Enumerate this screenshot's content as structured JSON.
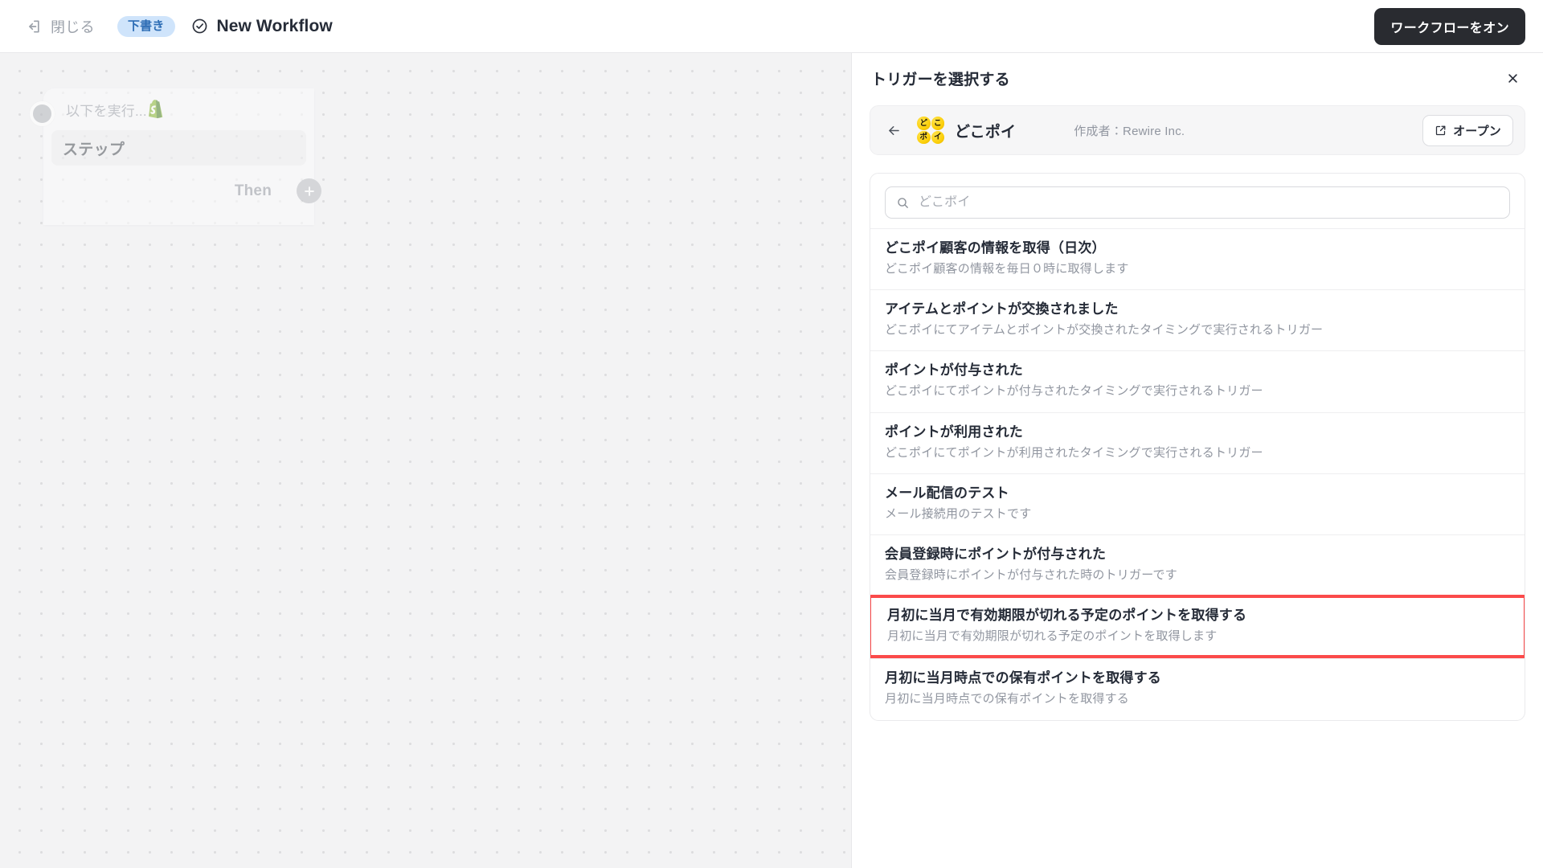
{
  "topbar": {
    "close_label": "閉じる",
    "close_icon": "exit-icon",
    "draft_badge": "下書き",
    "status_icon": "check-circle-icon",
    "workflow_title": "New Workflow",
    "activate_label": "ワークフローをオン",
    "accent_dark": "#292b30",
    "badge_bg": "#cfe4fb",
    "badge_fg": "#2d6db5"
  },
  "canvas": {
    "card": {
      "head_label": "以下を実行...",
      "app_icon": "shopify-icon",
      "step_label": "ステップ",
      "then_label": "Then",
      "add_icon": "plus-icon",
      "node_icon": "node-dot-icon"
    }
  },
  "panel": {
    "title": "トリガーを選択する",
    "close_icon": "close-icon",
    "app": {
      "back_icon": "arrow-left-icon",
      "logo_chars": [
        "ど",
        "こ",
        "ポ",
        "イ"
      ],
      "logo_color": "#fccf09",
      "name": "どこポイ",
      "author": "作成者：Rewire Inc.",
      "open_label": "オープン",
      "open_icon": "external-link-icon"
    },
    "search": {
      "icon": "search-icon",
      "value": "",
      "placeholder": "どこポイ"
    },
    "highlight_color": "#fb4a4a",
    "triggers": [
      {
        "name": "どこポイ顧客の情報を取得（日次）",
        "desc": "どこポイ顧客の情報を毎日０時に取得します",
        "highlighted": false
      },
      {
        "name": "アイテムとポイントが交換されました",
        "desc": "どこポイにてアイテムとポイントが交換されたタイミングで実行されるトリガー",
        "highlighted": false
      },
      {
        "name": "ポイントが付与された",
        "desc": "どこポイにてポイントが付与されたタイミングで実行されるトリガー",
        "highlighted": false
      },
      {
        "name": "ポイントが利用された",
        "desc": "どこポイにてポイントが利用されたタイミングで実行されるトリガー",
        "highlighted": false
      },
      {
        "name": "メール配信のテスト",
        "desc": "メール接続用のテストです",
        "highlighted": false
      },
      {
        "name": "会員登録時にポイントが付与された",
        "desc": "会員登録時にポイントが付与された時のトリガーです",
        "highlighted": false
      },
      {
        "name": "月初に当月で有効期限が切れる予定のポイントを取得する",
        "desc": "月初に当月で有効期限が切れる予定のポイントを取得します",
        "highlighted": true
      },
      {
        "name": "月初に当月時点での保有ポイントを取得する",
        "desc": "月初に当月時点での保有ポイントを取得する",
        "highlighted": false
      }
    ]
  }
}
